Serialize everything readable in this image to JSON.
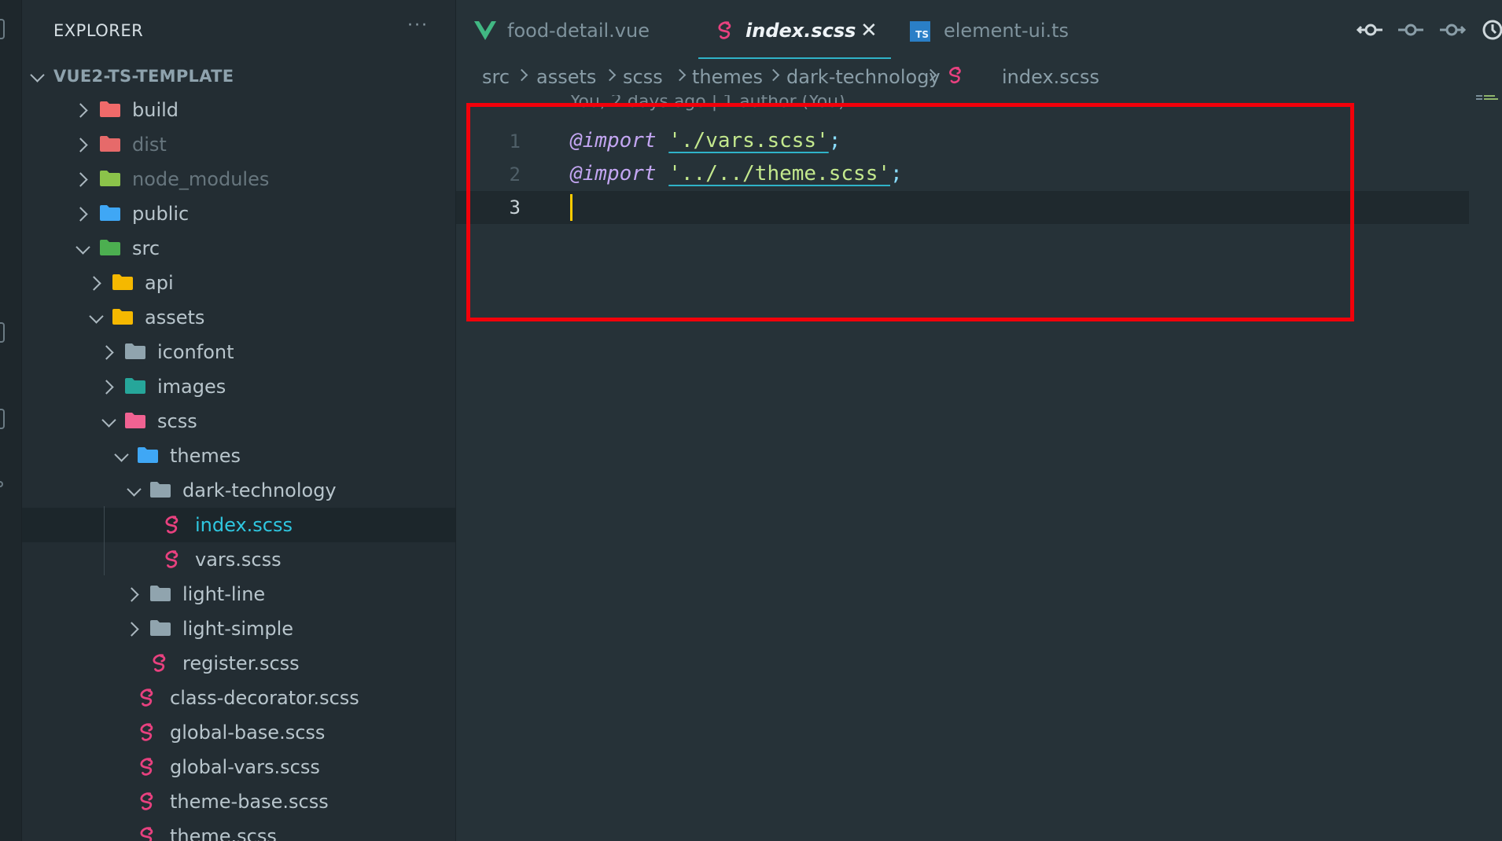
{
  "sidebar": {
    "title": "EXPLORER",
    "more": "···",
    "project": "VUE2-TS-TEMPLATE",
    "tree": [
      {
        "label": "build",
        "icon": "folder-build-icon",
        "expanded": false
      },
      {
        "label": "dist",
        "icon": "folder-dist-icon",
        "expanded": false,
        "dimmed": true
      },
      {
        "label": "node_modules",
        "icon": "folder-node-icon",
        "expanded": false,
        "dimmed": true
      },
      {
        "label": "public",
        "icon": "folder-public-icon",
        "expanded": false
      },
      {
        "label": "src",
        "icon": "folder-src-icon",
        "expanded": true
      },
      {
        "label": "api",
        "icon": "folder-api-icon",
        "expanded": false
      },
      {
        "label": "assets",
        "icon": "folder-assets-icon",
        "expanded": true
      },
      {
        "label": "iconfont",
        "icon": "folder-icon",
        "expanded": false
      },
      {
        "label": "images",
        "icon": "folder-images-icon",
        "expanded": false
      },
      {
        "label": "scss",
        "icon": "folder-scss-icon",
        "expanded": true
      },
      {
        "label": "themes",
        "icon": "folder-themes-icon",
        "expanded": true
      },
      {
        "label": "dark-technology",
        "icon": "folder-open-icon",
        "expanded": true
      },
      {
        "label": "index.scss",
        "icon": "sass-file-icon",
        "selected": true
      },
      {
        "label": "vars.scss",
        "icon": "sass-file-icon"
      },
      {
        "label": "light-line",
        "icon": "folder-icon",
        "expanded": false
      },
      {
        "label": "light-simple",
        "icon": "folder-icon",
        "expanded": false
      },
      {
        "label": "register.scss",
        "icon": "sass-file-icon"
      },
      {
        "label": "class-decorator.scss",
        "icon": "sass-file-icon"
      },
      {
        "label": "global-base.scss",
        "icon": "sass-file-icon"
      },
      {
        "label": "global-vars.scss",
        "icon": "sass-file-icon"
      },
      {
        "label": "theme-base.scss",
        "icon": "sass-file-icon"
      },
      {
        "label": "theme.scss",
        "icon": "sass-file-icon"
      }
    ]
  },
  "tabs": [
    {
      "label": "food-detail.vue",
      "icon": "vue-icon",
      "active": false
    },
    {
      "label": "index.scss",
      "icon": "sass-file-icon",
      "active": true,
      "close": "✕"
    },
    {
      "label": "element-ui.ts",
      "icon": "typescript-icon",
      "badge": "TS",
      "active": false
    }
  ],
  "breadcrumb": [
    "src",
    "assets",
    "scss",
    "themes",
    "dark-technology",
    "index.scss"
  ],
  "editor": {
    "blame": "You, 2 days ago | 1 author (You)",
    "lines": [
      {
        "number": "1",
        "keyword": "@import",
        "space": " ",
        "string": "'./vars.scss'",
        "semicolon": ";"
      },
      {
        "number": "2",
        "keyword": "@import",
        "space": " ",
        "string": "'../../theme.scss'",
        "semicolon": ";"
      },
      {
        "number": "3"
      }
    ],
    "current_line": 3
  },
  "colors": {
    "editor_bg": "#263238",
    "sidebar_bg": "#232d33",
    "selection_accent": "#2fc7e0",
    "sass_pink": "#e8417f",
    "highlight_box": "#f2000a",
    "caret": "#ffcc00"
  }
}
